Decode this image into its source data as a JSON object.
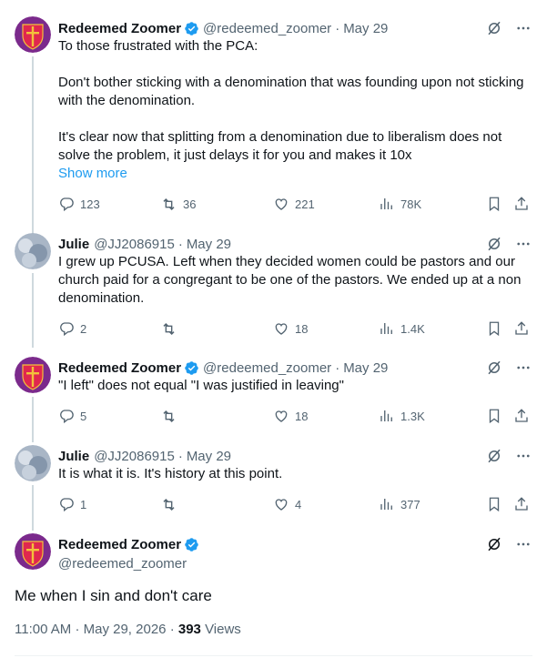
{
  "colors": {
    "accent": "#1d9bf0",
    "secondary_text": "#536471",
    "verified": "#1d9bf0"
  },
  "tweets": [
    {
      "name": "Redeemed Zoomer",
      "handle": "@redeemed_zoomer",
      "sep": "·",
      "date": "May 29",
      "paragraphs": [
        "To those frustrated with the PCA:",
        "Don't bother sticking with a denomination that was founding upon not sticking with the denomination.",
        "It's clear now that splitting from a denomination due to liberalism does not solve the problem, it just delays it for you and makes it 10x"
      ],
      "show_more": "Show more",
      "replies": "123",
      "retweets": "36",
      "likes": "221",
      "views": "78K"
    },
    {
      "name": "Julie",
      "handle": "@JJ2086915",
      "sep": "·",
      "date": "May 29",
      "text": "I grew up PCUSA. Left when they decided women could be pastors and our church paid for a congregant to be one of the pastors. We ended up at a non denomination.",
      "replies": "2",
      "retweets": "",
      "likes": "18",
      "views": "1.4K"
    },
    {
      "name": "Redeemed Zoomer",
      "handle": "@redeemed_zoomer",
      "sep": "·",
      "date": "May 29",
      "text": "\"I left\" does not equal \"I was justified in leaving\"",
      "replies": "5",
      "retweets": "",
      "likes": "18",
      "views": "1.3K"
    },
    {
      "name": "Julie",
      "handle": "@JJ2086915",
      "sep": "·",
      "date": "May 29",
      "text": "It is what it is. It's history at this point.",
      "replies": "1",
      "retweets": "",
      "likes": "4",
      "views": "377"
    }
  ],
  "main": {
    "name": "Redeemed Zoomer",
    "handle": "@redeemed_zoomer",
    "text": "Me when I sin and don't care",
    "time": "11:00 AM",
    "sep": "·",
    "date": "May 29, 2026",
    "views_sep": "·",
    "views_count": "393",
    "views_label": "Views"
  },
  "icons": [
    "reply-icon",
    "retweet-icon",
    "like-icon",
    "views-icon",
    "bookmark-icon",
    "share-icon",
    "grok-icon",
    "more-icon",
    "verified-icon"
  ]
}
